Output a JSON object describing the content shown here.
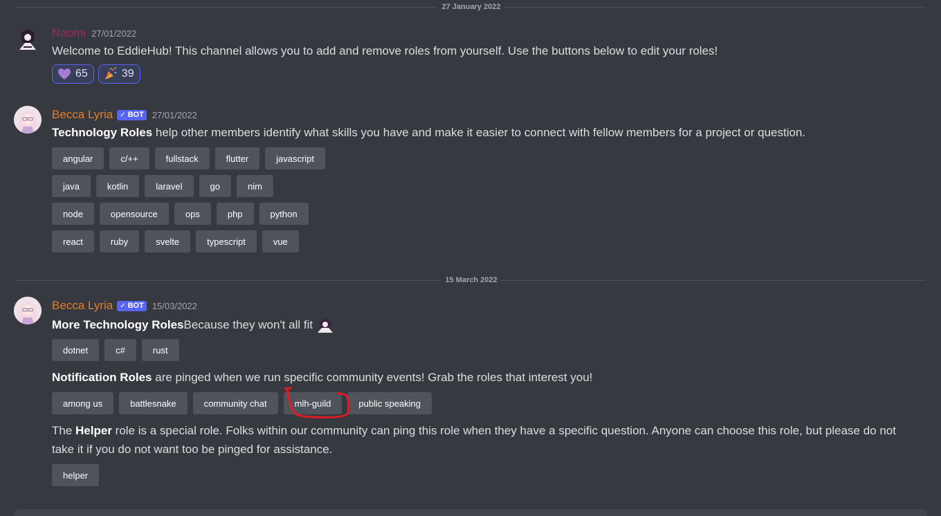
{
  "dividers": [
    "27 January 2022",
    "15 March 2022"
  ],
  "messages": {
    "naomi": {
      "username": "Naomi",
      "timestamp": "27/01/2022",
      "text": "Welcome to EddieHub! This channel allows you to add and remove roles from yourself. Use the buttons below to edit your roles!",
      "reactions": [
        {
          "emoji": "purple-heart-icon",
          "count": "65"
        },
        {
          "emoji": "party-popper-icon",
          "count": "39"
        }
      ]
    },
    "becca1": {
      "username": "Becca Lyria",
      "badge": "BOT",
      "timestamp": "27/01/2022",
      "title": "Technology Roles",
      "text": " help other members identify what skills you have and make it easier to connect with fellow members for a project or question.",
      "rows": [
        [
          "angular",
          "c/++",
          "fullstack",
          "flutter",
          "javascript"
        ],
        [
          "java",
          "kotlin",
          "laravel",
          "go",
          "nim"
        ],
        [
          "node",
          "opensource",
          "ops",
          "php",
          "python"
        ],
        [
          "react",
          "ruby",
          "svelte",
          "typescript",
          "vue"
        ]
      ]
    },
    "becca2": {
      "username": "Becca Lyria",
      "badge": "BOT",
      "timestamp": "15/03/2022",
      "more_title": "More Technology Roles",
      "more_text": " Because they won't all fit",
      "more_roles": [
        "dotnet",
        "c#",
        "rust"
      ],
      "notif_title": "Notification Roles",
      "notif_text": " are pinged when we run specific community events! Grab the roles that interest you!",
      "notif_roles": [
        "among us",
        "battlesnake",
        "community chat",
        "mlh-guild",
        "public speaking"
      ],
      "helper_pre": "The ",
      "helper_title": "Helper",
      "helper_text": " role is a special role. Folks within our community can ping this role when they have a specific question. Anyone can choose this role, but please do not take it if you do not want too be pinged for assistance.",
      "helper_roles": [
        "helper"
      ]
    }
  },
  "colors": {
    "background": "#36393f",
    "button": "#4f545c",
    "naomi_name": "#9b2d5b",
    "becca_name": "#e67e22",
    "bot_badge": "#5865f2",
    "annotation": "#e01b24"
  }
}
